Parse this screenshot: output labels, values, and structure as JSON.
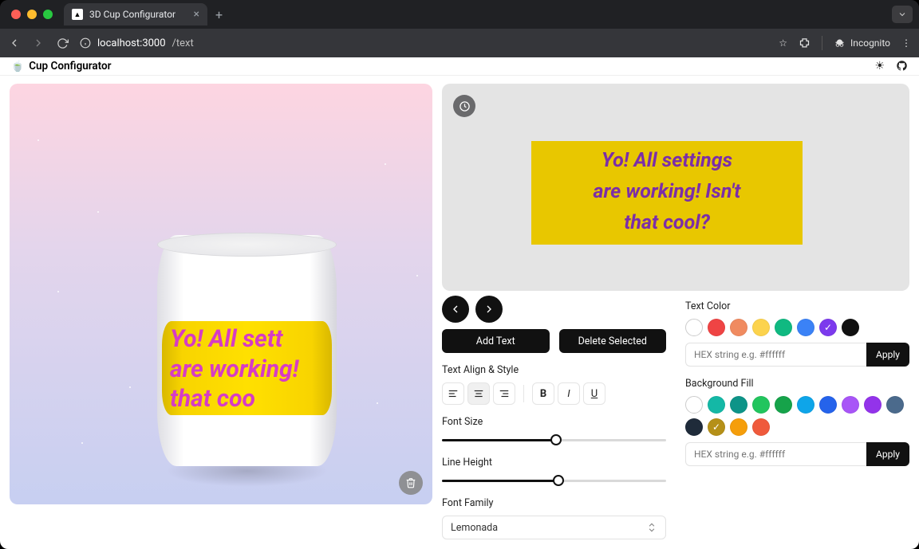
{
  "browser": {
    "tab_title": "3D Cup Configurator",
    "url_host": "localhost:",
    "url_port": "3000",
    "url_path": "/text",
    "incognito_label": "Incognito"
  },
  "appbar": {
    "title": "Cup Configurator"
  },
  "design_text": "Yo! All settings\nare working! Isn't\nthat cool?",
  "mug_text": "Yo! All sett\nare working!\nthat coo",
  "controls": {
    "add_text": "Add Text",
    "delete_selected": "Delete Selected",
    "align_label": "Text Align & Style",
    "font_size_label": "Font Size",
    "line_height_label": "Line Height",
    "font_family_label": "Font Family",
    "font_family_value": "Lemonada",
    "font_size_pct": 51,
    "line_height_pct": 52
  },
  "text_color": {
    "label": "Text Color",
    "hex_placeholder": "HEX string e.g. #ffffff",
    "apply": "Apply",
    "swatches": [
      "#ffffff",
      "#ef4444",
      "#f08b60",
      "#fcd34d",
      "#10b981",
      "#3b82f6",
      "#7c3aed",
      "#111111"
    ],
    "selected_index": 6
  },
  "bg_fill": {
    "label": "Background Fill",
    "hex_placeholder": "HEX string e.g. #ffffff",
    "apply": "Apply",
    "swatches_row1": [
      "#ffffff",
      "#14b8a6",
      "#0d9488",
      "#22c55e",
      "#16a34a",
      "#0ea5e9",
      "#2563eb",
      "#a855f7",
      "#9333ea"
    ],
    "swatches_row2": [
      "#4b6a8c",
      "#1f2b3a",
      "#b59018",
      "#f59e0b",
      "#ef5a3c"
    ],
    "selected_row": 2,
    "selected_index": 2
  }
}
